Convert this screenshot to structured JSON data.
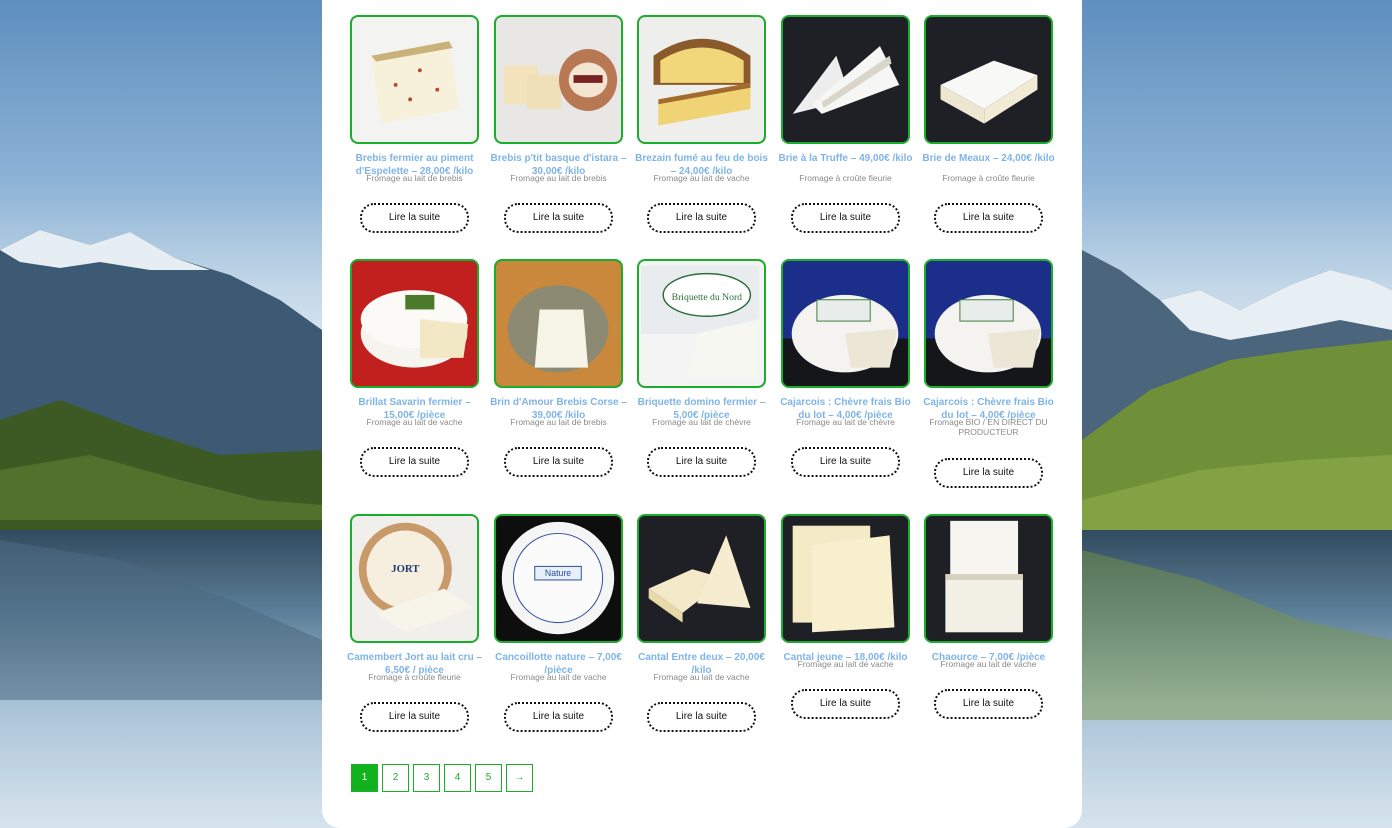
{
  "colors": {
    "accent_green": "#1bad2c",
    "title_blue": "#7fb4e6",
    "category_gray": "#8a8a8a"
  },
  "products": [
    {
      "title": "Brebis fermier au piment d'Espelette – 28,00€ /kilo",
      "category": "Fromage au lait de brebis",
      "button": "Lire la suite",
      "image": "wedge-cheese-red-flecks"
    },
    {
      "title": "Brebis p'tit basque d'istara – 30,00€ /kilo",
      "category": "Fromage au lait de brebis",
      "button": "Lire la suite",
      "image": "ptit-basque-wheel"
    },
    {
      "title": "Brezain fumé au feu de bois – 24,00€ /kilo",
      "category": "Fromage au lait de vache",
      "button": "Lire la suite",
      "image": "smoked-cheese-wedge"
    },
    {
      "title": "Brie à la Truffe – 49,00€ /kilo",
      "category": "Fromage à croûte fleurie",
      "button": "Lire la suite",
      "image": "brie-truffle-slices"
    },
    {
      "title": "Brie de Meaux – 24,00€ /kilo",
      "category": "Fromage à croûte fleurie",
      "button": "Lire la suite",
      "image": "brie-de-meaux-slice"
    },
    {
      "title": "Brillat Savarin fermier – 15,00€ /pièce",
      "category": "Fromage au lait de vache",
      "button": "Lire la suite",
      "image": "brillat-savarin-wheel"
    },
    {
      "title": "Brin d'Amour Brebis Corse – 39,00€ /kilo",
      "category": "Fromage au lait de brebis",
      "button": "Lire la suite",
      "image": "brin-damour-herbed-wheel"
    },
    {
      "title": "Briquette domino fermier – 5,00€ /pièce",
      "category": "Fromage au lait de chèvre",
      "button": "Lire la suite",
      "image": "briquette-du-nord-pack"
    },
    {
      "title": "Cajarcois : Chèvre frais Bio du lot – 4,00€ /pièce",
      "category": "Fromage au lait de chèvre",
      "button": "Lire la suite",
      "image": "cajarcois-goat-cheese"
    },
    {
      "title": "Cajarcois : Chèvre frais Bio du lot – 4,00€ /pièce",
      "category": "Fromage BIO / EN DIRECT DU PRODUCTEUR",
      "button": "Lire la suite",
      "image": "cajarcois-goat-cheese"
    },
    {
      "title": "Camembert Jort au lait cru – 6,50€ / pièce",
      "category": "Fromage à croûte fleurie",
      "button": "Lire la suite",
      "image": "camembert-jort-box"
    },
    {
      "title": "Cancoillotte nature – 7,00€ /pièce",
      "category": "Fromage au lait de vache",
      "button": "Lire la suite",
      "image": "cancoillotte-tub"
    },
    {
      "title": "Cantal Entre deux – 20,00€ /kilo",
      "category": "Fromage au lait de vache",
      "button": "Lire la suite",
      "image": "cantal-wedges"
    },
    {
      "title": "Cantal jeune – 18,00€ /kilo",
      "category": "Fromage au lait de vache",
      "button": "Lire la suite",
      "image": "cantal-jeune-blocks"
    },
    {
      "title": "Chaource – 7,00€ /pièce",
      "category": "Fromage au lait de vache",
      "button": "Lire la suite",
      "image": "chaource-stack"
    }
  ],
  "pagination": {
    "pages": [
      "1",
      "2",
      "3",
      "4",
      "5"
    ],
    "current": "1",
    "next": "→"
  }
}
